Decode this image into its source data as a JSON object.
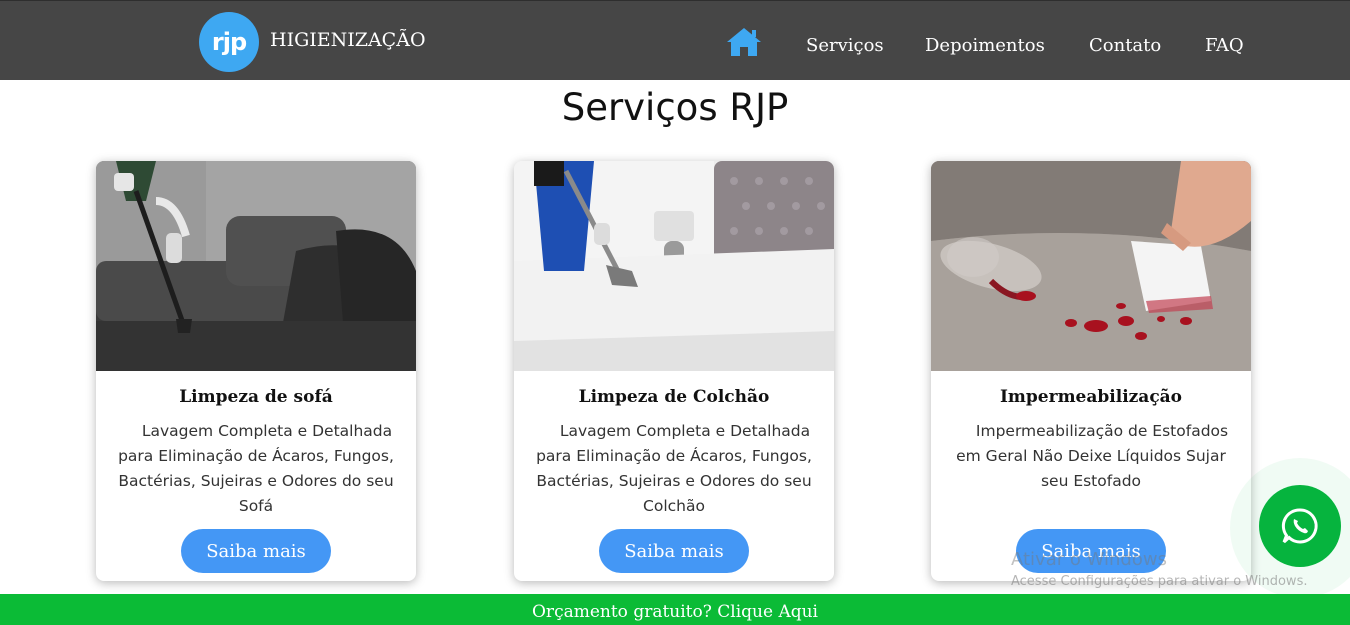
{
  "header": {
    "logo_text": "rjp",
    "brand": "HIGIENIZAÇÃO",
    "nav": [
      {
        "label": "Serviços"
      },
      {
        "label": "Depoimentos"
      },
      {
        "label": "Contato"
      },
      {
        "label": "FAQ"
      }
    ]
  },
  "section": {
    "title": "Serviços RJP"
  },
  "cards": [
    {
      "title": "Limpeza de sofá",
      "text": "Lavagem Completa e Detalhada para Eliminação de Ácaros, Fungos, Bactérias, Sujeiras e Odores do seu Sofá",
      "button": "Saiba mais"
    },
    {
      "title": "Limpeza de Colchão",
      "text": "Lavagem Completa e Detalhada para Eliminação de Ácaros, Fungos, Bactérias, Sujeiras e Odores do seu Colchão",
      "button": "Saiba mais"
    },
    {
      "title": "Impermeabilização",
      "text": "Impermeabilização de Estofados em Geral Não Deixe Líquidos Sujar seu Estofado",
      "button": "Saiba mais"
    }
  ],
  "watermark": {
    "title": "Ativar o Windows",
    "subtitle": "Acesse Configurações para ativar o Windows."
  },
  "footer": {
    "cta": "Orçamento gratuito? Clique Aqui"
  },
  "colors": {
    "header_bg": "#464646",
    "accent_blue": "#4497f5",
    "whatsapp_green": "#06b43e",
    "footer_green": "#0bbb36"
  }
}
